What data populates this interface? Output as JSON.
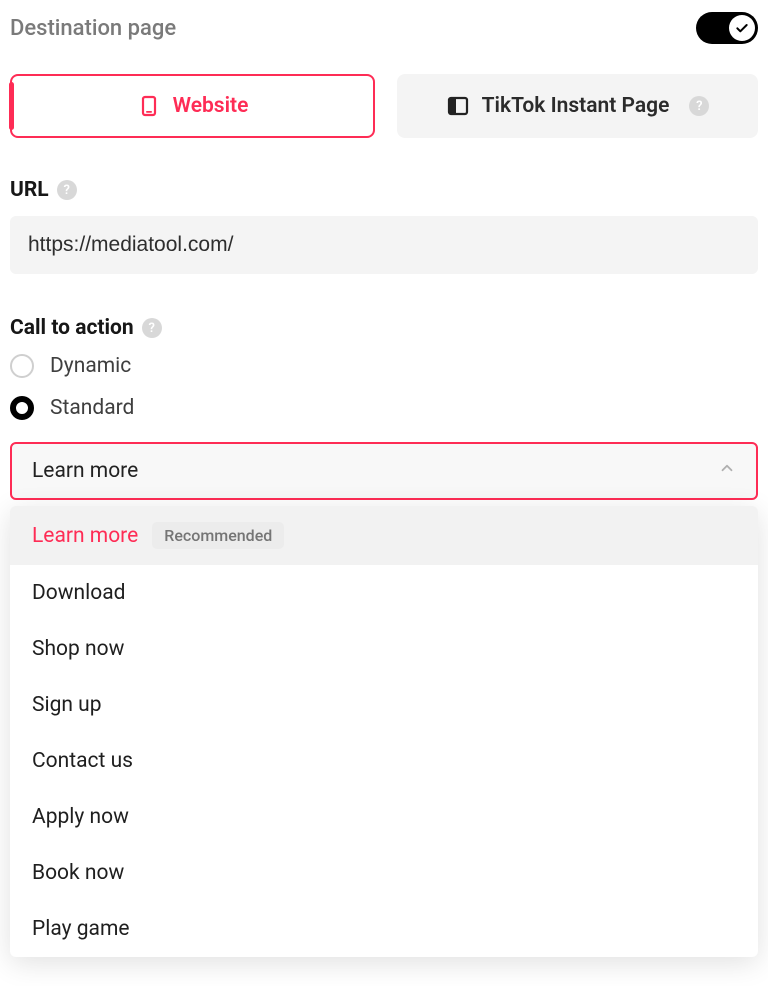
{
  "section": {
    "title": "Destination page",
    "toggle_on": true
  },
  "tabs": {
    "website": "Website",
    "instant_page": "TikTok Instant Page"
  },
  "url_section": {
    "label": "URL",
    "value": "https://mediatool.com/"
  },
  "cta_section": {
    "label": "Call to action",
    "radio_dynamic": "Dynamic",
    "radio_standard": "Standard",
    "selected_radio": "standard",
    "select_value": "Learn more",
    "recommended_badge": "Recommended",
    "options": [
      "Learn more",
      "Download",
      "Shop now",
      "Sign up",
      "Contact us",
      "Apply now",
      "Book now",
      "Play game"
    ]
  }
}
